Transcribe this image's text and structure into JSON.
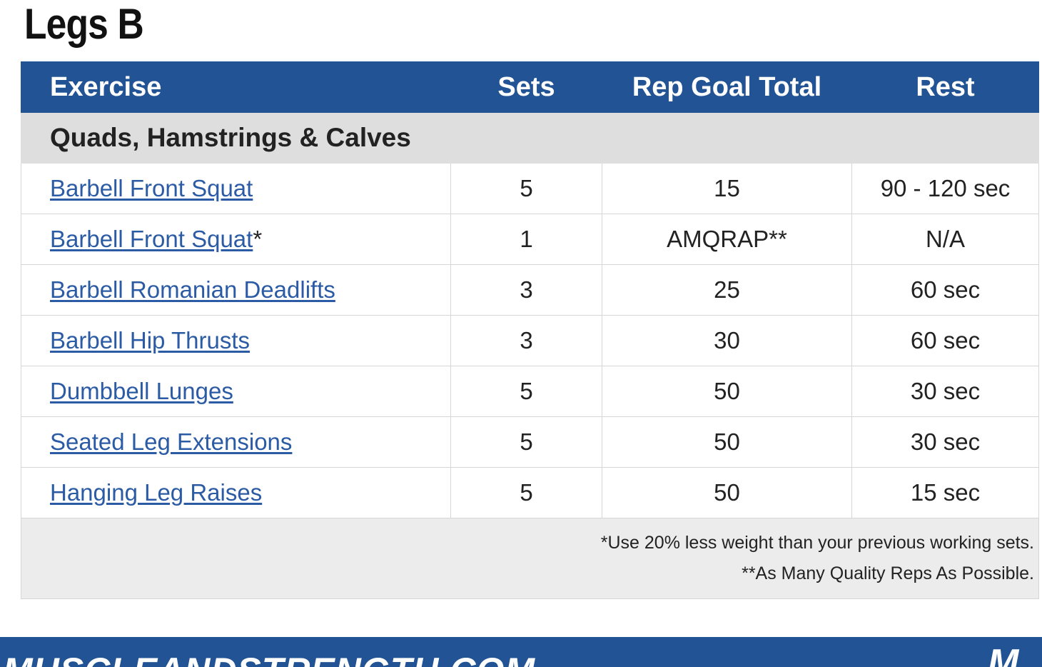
{
  "page": {
    "title": "Legs B"
  },
  "table": {
    "headers": {
      "exercise": "Exercise",
      "sets": "Sets",
      "rep_goal_total": "Rep Goal Total",
      "rest": "Rest"
    },
    "section": "Quads, Hamstrings & Calves",
    "rows": [
      {
        "exercise": "Barbell Front Squat",
        "marker": "",
        "sets": "5",
        "reps": "15",
        "rest": "90 - 120 sec"
      },
      {
        "exercise": "Barbell Front Squat",
        "marker": "*",
        "sets": "1",
        "reps": "AMQRAP**",
        "rest": "N/A"
      },
      {
        "exercise": "Barbell Romanian Deadlifts",
        "marker": "",
        "sets": "3",
        "reps": "25",
        "rest": "60 sec"
      },
      {
        "exercise": "Barbell Hip Thrusts",
        "marker": "",
        "sets": "3",
        "reps": "30",
        "rest": "60 sec"
      },
      {
        "exercise": "Dumbbell Lunges",
        "marker": "",
        "sets": "5",
        "reps": "50",
        "rest": "30 sec"
      },
      {
        "exercise": "Seated Leg Extensions",
        "marker": "",
        "sets": "5",
        "reps": "50",
        "rest": "30 sec"
      },
      {
        "exercise": "Hanging Leg Raises",
        "marker": "",
        "sets": "5",
        "reps": "50",
        "rest": "15 sec"
      }
    ],
    "notes": [
      "*Use 20% less weight than your previous working sets.",
      "**As Many Quality Reps As Possible."
    ]
  },
  "footer": {
    "brand": "MUSCLEANDSTRENGTH.COM",
    "logo": "M"
  },
  "colors": {
    "header_bg": "#225394",
    "section_bg": "#dedede",
    "notes_bg": "#ececec",
    "link": "#2b5ba4",
    "footer_bg": "#225394"
  }
}
